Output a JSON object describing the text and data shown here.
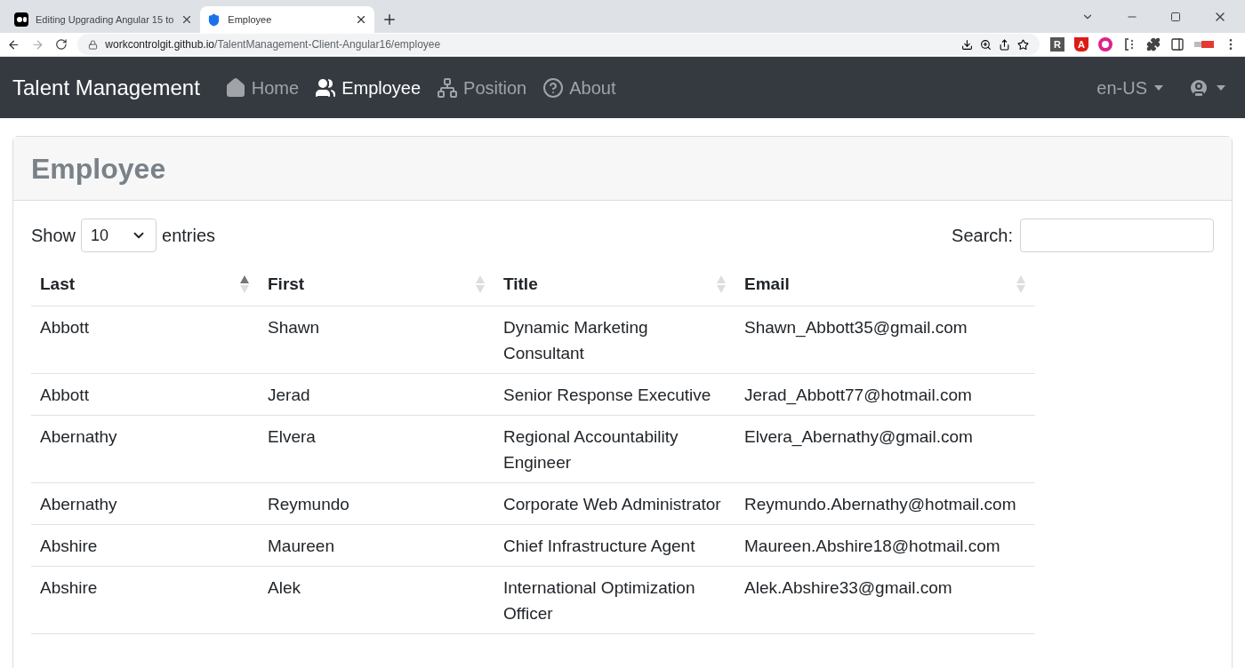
{
  "browser": {
    "tabs": [
      {
        "title": "Editing Upgrading Angular 15 to",
        "kind": "medium",
        "selected": false
      },
      {
        "title": "Employee",
        "kind": "shield",
        "selected": true
      }
    ],
    "url_host": "workcontrolgit.github.io",
    "url_path": "/TalentManagement-Client-Angular16/employee",
    "extensions": [
      {
        "kind": "letter",
        "label": "R"
      },
      {
        "kind": "angular",
        "label": "A"
      },
      {
        "kind": "ring"
      },
      {
        "kind": "bracket"
      },
      {
        "kind": "puzzle"
      },
      {
        "kind": "sidepanel"
      },
      {
        "kind": "badge"
      }
    ]
  },
  "navbar": {
    "brand": "Talent Management",
    "items": [
      {
        "label": "Home",
        "kind": "home",
        "selected": false
      },
      {
        "label": "Employee",
        "kind": "users",
        "selected": true
      },
      {
        "label": "Position",
        "kind": "sitemap",
        "selected": false
      },
      {
        "label": "About",
        "kind": "question",
        "selected": false
      }
    ],
    "language": "en-US"
  },
  "card": {
    "title": "Employee",
    "show_label": "Show",
    "page_size": "10",
    "entries_label": "entries",
    "search_label": "Search:",
    "table": {
      "columns": [
        {
          "label": "Last",
          "selected": true
        },
        {
          "label": "First",
          "selected": false
        },
        {
          "label": "Title",
          "selected": false
        },
        {
          "label": "Email",
          "selected": false
        }
      ],
      "rows": [
        [
          "Abbott",
          "Shawn",
          "Dynamic Marketing Consultant",
          "Shawn_Abbott35@gmail.com"
        ],
        [
          "Abbott",
          "Jerad",
          "Senior Response Executive",
          "Jerad_Abbott77@hotmail.com"
        ],
        [
          "Abernathy",
          "Elvera",
          "Regional Accountability Engineer",
          "Elvera_Abernathy@gmail.com"
        ],
        [
          "Abernathy",
          "Reymundo",
          "Corporate Web Administrator",
          "Reymundo.Abernathy@hotmail.com"
        ],
        [
          "Abshire",
          "Maureen",
          "Chief Infrastructure Agent",
          "Maureen.Abshire18@hotmail.com"
        ],
        [
          "Abshire",
          "Alek",
          "International Optimization Officer",
          "Alek.Abshire33@gmail.com"
        ]
      ]
    }
  }
}
